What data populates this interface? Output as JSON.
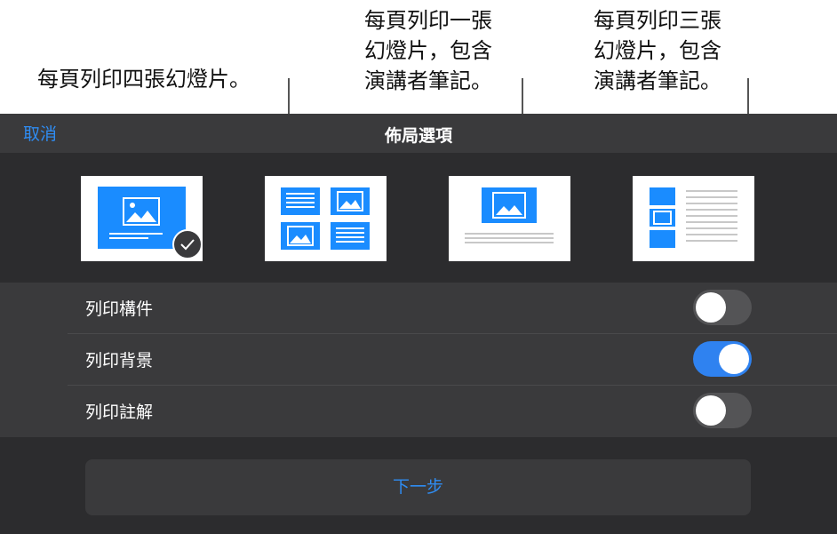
{
  "callouts": {
    "four_per_page": "每頁列印四張幻燈片。",
    "one_with_notes": "每頁列印一張\n幻燈片，包含\n演講者筆記。",
    "three_with_notes": "每頁列印三張\n幻燈片，包含\n演講者筆記。"
  },
  "nav": {
    "cancel_label": "取消",
    "title": "佈局選項"
  },
  "layouts": [
    {
      "icon": "single-slide-layout-icon",
      "selected": true
    },
    {
      "icon": "four-slides-layout-icon",
      "selected": false
    },
    {
      "icon": "slide-with-notes-layout-icon",
      "selected": false
    },
    {
      "icon": "three-slides-with-notes-layout-icon",
      "selected": false
    }
  ],
  "options": [
    {
      "label": "列印構件",
      "on": false
    },
    {
      "label": "列印背景",
      "on": true
    },
    {
      "label": "列印註解",
      "on": false
    }
  ],
  "next_label": "下一步",
  "colors": {
    "accent": "#2f8cf2",
    "slide_blue": "#1a8cff",
    "sheet_bg": "#2c2c2e",
    "panel_bg": "#3a3a3c"
  }
}
